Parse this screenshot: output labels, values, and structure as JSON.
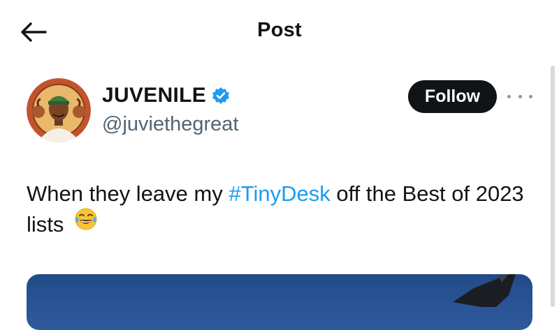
{
  "header": {
    "title": "Post",
    "back_icon": "arrow-left-icon"
  },
  "author": {
    "display_name": "JUVENILE",
    "handle": "@juviethegreat",
    "verified": true,
    "verified_color": "#1d9bf0"
  },
  "actions": {
    "follow_label": "Follow",
    "more_icon": "more-horizontal-icon"
  },
  "post": {
    "text_before": "When they leave my ",
    "hashtag": "#TinyDesk",
    "text_after": " off the Best of 2023 lists",
    "emoji_icon": "face-with-tears-of-joy-icon"
  },
  "colors": {
    "link": "#1d9bf0",
    "text": "#0f1419",
    "secondary": "#536471",
    "button": "#0f1419"
  }
}
